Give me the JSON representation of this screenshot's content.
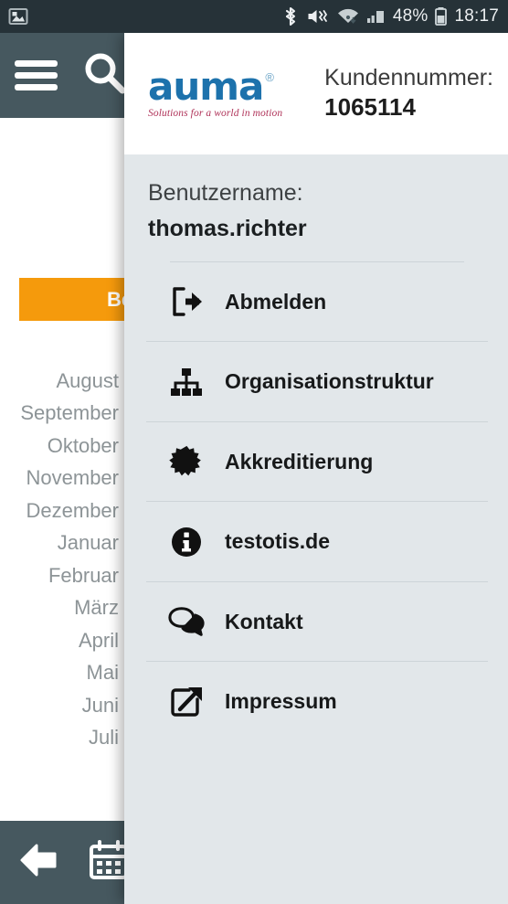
{
  "statusbar": {
    "notification_icon": "photo-gallery-icon",
    "icons": [
      "bluetooth-icon",
      "volume-mute-vibrate-icon",
      "wifi-icon",
      "cellular-signal-icon"
    ],
    "battery_percent": "48%",
    "battery_icon": "battery-icon",
    "time": "18:17"
  },
  "background_app": {
    "toolbar": {
      "menu_icon": "hamburger-menu-icon",
      "search_icon": "search-icon"
    },
    "primary_button_label": "Be",
    "months": [
      "August",
      "September",
      "Oktober",
      "November",
      "Dezember",
      "Januar",
      "Februar",
      "März",
      "April",
      "Mai",
      "Juni",
      "Juli"
    ],
    "bottombar": {
      "back_icon": "back-arrow-icon",
      "calendar_icon": "calendar-icon"
    }
  },
  "drawer": {
    "logo": {
      "wordmark": "auma",
      "registered": "®",
      "tagline": "Solutions for a world in motion"
    },
    "customer": {
      "label": "Kundennummer:",
      "value": "1065114"
    },
    "user": {
      "label": "Benutzername:",
      "value": "thomas.richter"
    },
    "menu": [
      {
        "label": "Abmelden",
        "icon": "logout-icon"
      },
      {
        "label": "Organisationstruktur",
        "icon": "org-chart-icon"
      },
      {
        "label": "Akkreditierung",
        "icon": "certificate-badge-icon"
      },
      {
        "label": "testotis.de",
        "icon": "info-circle-icon"
      },
      {
        "label": "Kontakt",
        "icon": "chat-bubbles-icon"
      },
      {
        "label": "Impressum",
        "icon": "external-link-icon"
      }
    ]
  },
  "colors": {
    "statusbar_bg": "#263238",
    "toolbar_bg": "#46585f",
    "drawer_bg": "#e2e7ea",
    "accent_orange": "#f59a0c",
    "logo_blue": "#1d72ac",
    "logo_red": "#b0345a",
    "month_text": "#8d9497"
  }
}
